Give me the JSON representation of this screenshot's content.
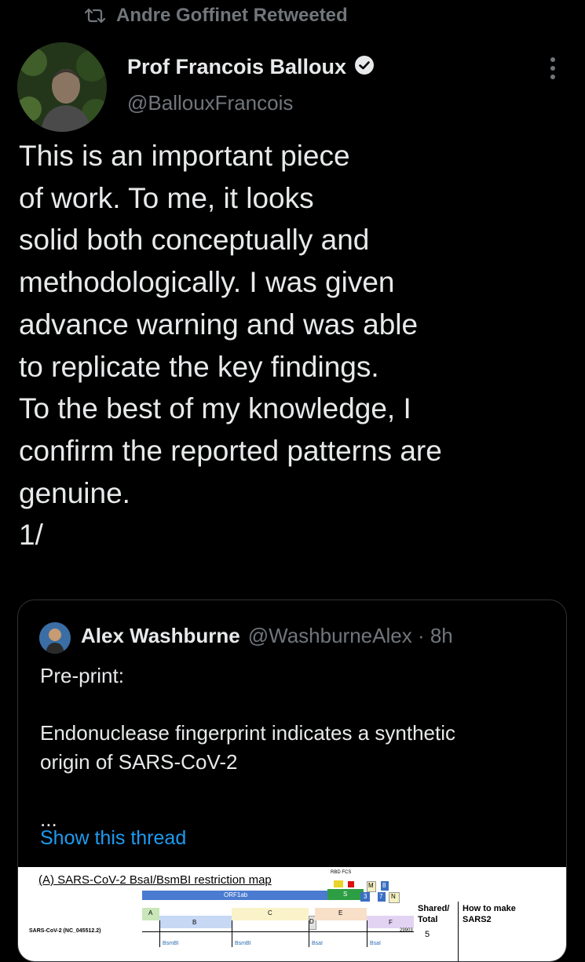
{
  "retweet": {
    "label": "Andre Goffinet Retweeted",
    "icon": "retweet-icon"
  },
  "author": {
    "name": "Prof Francois Balloux",
    "handle": "@BallouxFrancois",
    "verified_icon": "verified-badge-icon"
  },
  "tweet_text": "This is an important piece\nof work. To me, it looks\nsolid both conceptually and\nmethodologically. I was given\nadvance warning and was able\nto replicate the key findings.\nTo the best of my knowledge, I\nconfirm the reported patterns are\ngenuine.\n1/",
  "quote": {
    "name": "Alex Washburne",
    "handle": "@WashburneAlex",
    "time": "8h",
    "meta": "@WashburneAlex · 8h",
    "text": "Pre-print:\n\nEndonuclease fingerprint indicates a synthetic\norigin of SARS-CoV-2\n\n...",
    "show_thread": "Show this thread",
    "figure": {
      "title": "(A) SARS-CoV-2 BsaI/BsmBI restriction map",
      "rbd_label": "RBD FCS",
      "orf_label": "ORF1ab",
      "genome_label": "SARS-CoV-2 (NC_045512.2)",
      "genome_end": "29903",
      "segments": [
        "A",
        "B",
        "C",
        "D",
        "E",
        "F"
      ],
      "genes": [
        "S",
        "3",
        "7",
        "N",
        "M",
        "8"
      ],
      "sites": [
        "BsmBI",
        "BsmBI",
        "BsaI",
        "BsaI"
      ],
      "col1": "Shared/\nTotal",
      "col2": "How to make\nSARS2",
      "count": "5"
    }
  },
  "colors": {
    "accent": "#1d9bf0",
    "secondary": "#71767b",
    "text": "#e7e9ea",
    "border": "#2f3336"
  }
}
